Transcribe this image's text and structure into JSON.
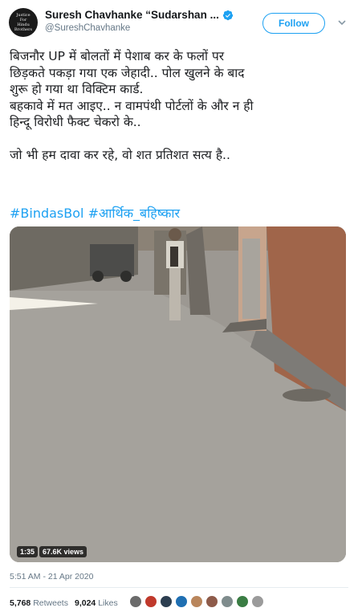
{
  "header": {
    "avatar_text": [
      "Justice",
      "For",
      "Hindu Brothers"
    ],
    "display_name": "Suresh Chavhanke “Sudarshan ...",
    "handle": "@SureshChavhanke",
    "follow_label": "Follow",
    "verified_icon": "verified-badge-icon",
    "chevron_icon": "chevron-down-icon",
    "accent_color": "#1da1f2"
  },
  "tweet": {
    "lines": [
      "बिजनौर UP में बोलतों में पेशाब कर के फलों पर",
      "छिड़कते पकड़ा गया एक जेहादी.. पोल खुलने के बाद",
      "शुरू हो गया था विक्टिम कार्ड.",
      "बहकावे में मत आइए.. न वामपंथी पोर्टलों के और न ही",
      "हिन्दू विरोधी फैक्ट चेकरो के..",
      "जो भी हम दावा कर रहे, वो शत प्रतिशत सत्य है.."
    ],
    "hashtags": [
      "#BindasBol",
      "#आर्थिक_बहिष्कार"
    ]
  },
  "media": {
    "duration": "1:35",
    "views": "67.6K views"
  },
  "timestamp": "5:51 AM - 21 Apr 2020",
  "stats": {
    "retweets_count": "5,768",
    "retweets_label": "Retweets",
    "likes_count": "9,024",
    "likes_label": "Likes"
  },
  "likers": [
    {
      "icon": "liker-avatar-1",
      "color": "#6b6b6b"
    },
    {
      "icon": "liker-avatar-2",
      "color": "#c0392b"
    },
    {
      "icon": "liker-avatar-3",
      "color": "#2c3e50"
    },
    {
      "icon": "liker-avatar-4",
      "color": "#1f6fb2"
    },
    {
      "icon": "liker-avatar-5",
      "color": "#b9865c"
    },
    {
      "icon": "liker-avatar-6",
      "color": "#8e5b4a"
    },
    {
      "icon": "liker-avatar-7",
      "color": "#7f8c8d"
    },
    {
      "icon": "liker-avatar-8",
      "color": "#3a7d44"
    },
    {
      "icon": "liker-avatar-9",
      "color": "#9b9b9b"
    }
  ]
}
